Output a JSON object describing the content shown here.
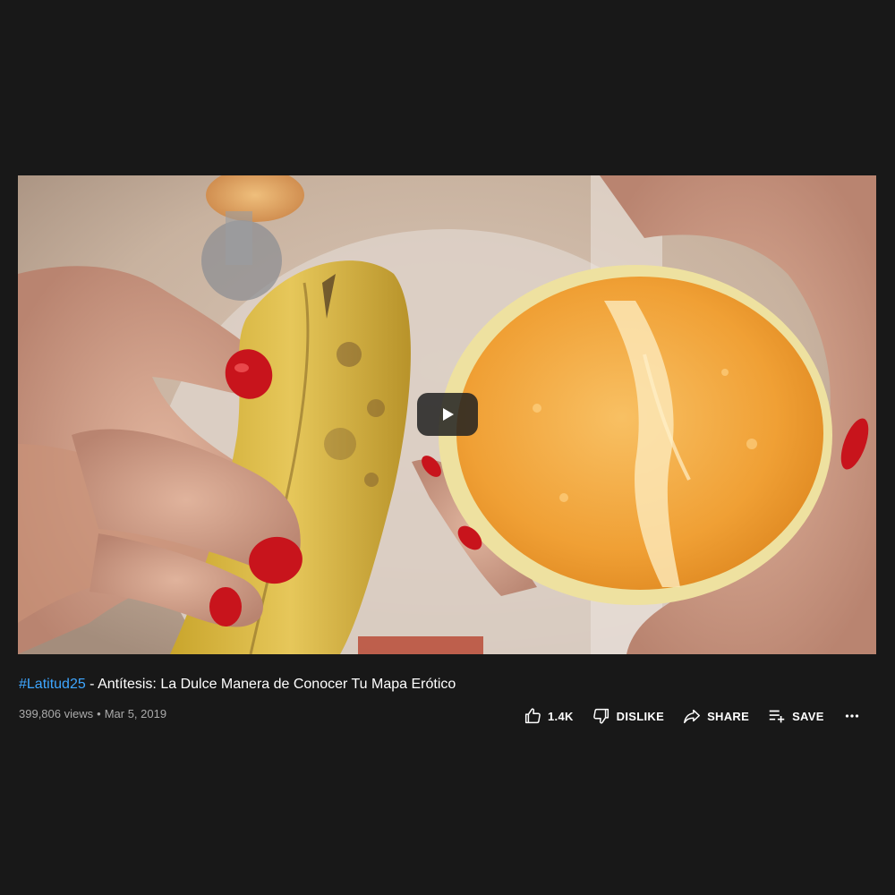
{
  "video": {
    "play_icon": "play-icon",
    "thumbnail_description_icon": "video-frame"
  },
  "title": {
    "hashtag": "#Latitud25",
    "rest": " - Antítesis: La Dulce Manera de Conocer Tu Mapa Erótico"
  },
  "meta": {
    "views": "399,806 views",
    "separator": "•",
    "date": "Mar 5, 2019"
  },
  "actions": {
    "like_count": "1.4K",
    "dislike_label": "DISLIKE",
    "share_label": "SHARE",
    "save_label": "SAVE",
    "more_icon": "more-horizontal-icon"
  },
  "colors": {
    "background": "#181818",
    "link": "#3ea6ff",
    "secondary_text": "#aaaaaa",
    "nail_polish": "#c8141c",
    "orange_flesh": "#f2a23a",
    "banana": "#d9b840"
  }
}
